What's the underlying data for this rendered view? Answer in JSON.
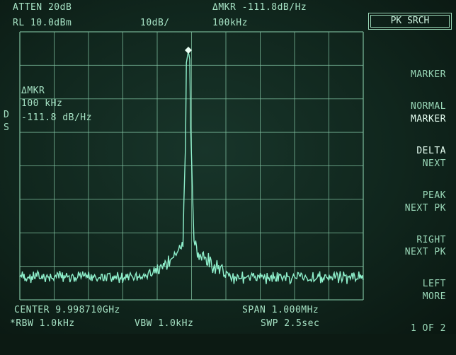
{
  "header": {
    "atten": "ATTEN 20dB",
    "rl": "RL 10.0dBm",
    "scale": "10dB/",
    "delta_mkr_top": "ΔMKR -111.8dB/Hz",
    "delta_freq_top": "100kHz"
  },
  "marker_readout": {
    "label": "ΔMKR",
    "freq": "100 kHz",
    "level": "-111.8 dB/Hz"
  },
  "side_label": {
    "d": "D",
    "s": "S"
  },
  "footer": {
    "center": "CENTER 9.998710GHz",
    "span": "SPAN 1.000MHz",
    "rbw": "*RBW 1.0kHz",
    "vbw": "VBW 1.0kHz",
    "swp": "SWP 2.5sec"
  },
  "menu": {
    "title": "PK SRCH",
    "items": [
      {
        "line1": "MARKER",
        "line2": "NORMAL",
        "active": false
      },
      {
        "line1": "MARKER",
        "line2": "DELTA",
        "active": true
      },
      {
        "line1": "NEXT",
        "line2": "PEAK",
        "active": false
      },
      {
        "line1": "NEXT PK",
        "line2": "RIGHT",
        "active": false
      },
      {
        "line1": "NEXT PK",
        "line2": "LEFT",
        "active": false
      },
      {
        "line1": "MORE",
        "line2": "1 OF 2",
        "active": false
      }
    ]
  },
  "colors": {
    "trace": "#8ff0cc",
    "grid": "#7fbf9f",
    "text": "#a6e2c4"
  },
  "icons": {
    "marker": "marker-diamond-icon"
  }
}
